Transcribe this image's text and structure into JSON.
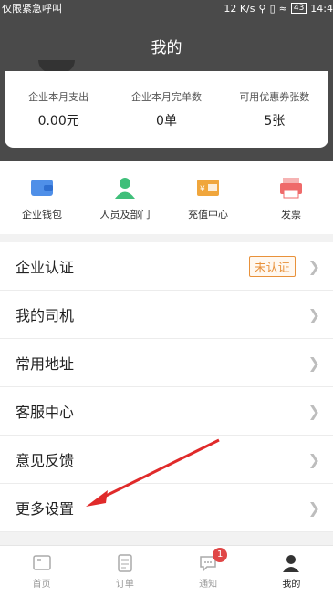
{
  "status_bar": {
    "carrier": "仅限紧急呼叫",
    "speed": "12 K/s",
    "battery": "43",
    "time": "14:4"
  },
  "header": {
    "title": "我的"
  },
  "stats": [
    {
      "label": "企业本月支出",
      "value": "0.00元"
    },
    {
      "label": "企业本月完单数",
      "value": "0单"
    },
    {
      "label": "可用优惠券张数",
      "value": "5张"
    }
  ],
  "quick_actions": [
    {
      "label": "企业钱包",
      "icon": "wallet-icon",
      "color": "#4f8fe8"
    },
    {
      "label": "人员及部门",
      "icon": "people-icon",
      "color": "#3fbf7a"
    },
    {
      "label": "充值中心",
      "icon": "recharge-icon",
      "color": "#f0a63c"
    },
    {
      "label": "发票",
      "icon": "invoice-icon",
      "color": "#ef6a6a"
    }
  ],
  "menu": [
    {
      "label": "企业认证",
      "badge": "未认证"
    },
    {
      "label": "我的司机"
    },
    {
      "label": "常用地址"
    },
    {
      "label": "客服中心"
    },
    {
      "label": "意见反馈"
    },
    {
      "label": "更多设置"
    }
  ],
  "tabs": [
    {
      "label": "首页",
      "icon": "home-icon"
    },
    {
      "label": "订单",
      "icon": "orders-icon"
    },
    {
      "label": "通知",
      "icon": "notification-icon",
      "badge": "1"
    },
    {
      "label": "我的",
      "icon": "profile-icon",
      "active": true
    }
  ],
  "colors": {
    "header_bg": "#4a4a4a",
    "badge_orange": "#e8913a",
    "arrow_red": "#e02a2a"
  }
}
